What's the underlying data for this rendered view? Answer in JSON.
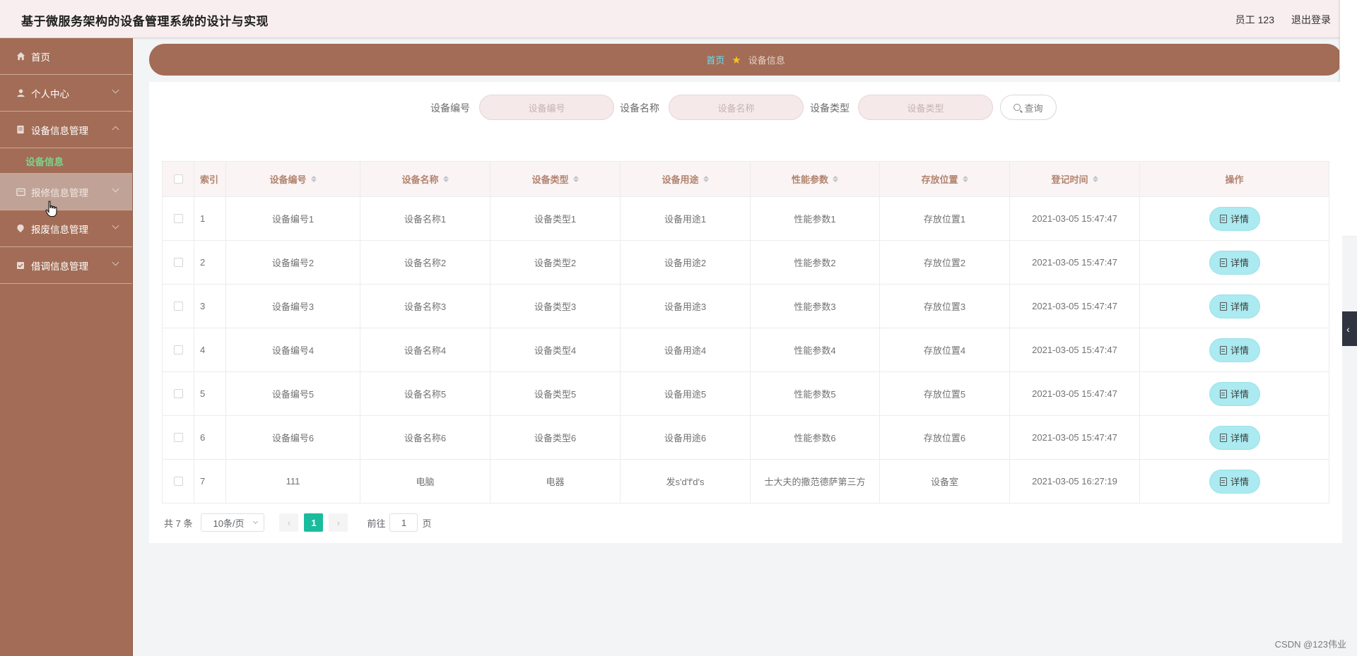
{
  "header": {
    "title": "基于微服务架构的设备管理系统的设计与实现",
    "user": "员工 123",
    "logout": "退出登录"
  },
  "sidebar": {
    "items": [
      {
        "label": "首页",
        "icon": "home-icon"
      },
      {
        "label": "个人中心",
        "icon": "user-icon"
      },
      {
        "label": "设备信息管理",
        "icon": "device-icon"
      },
      {
        "label": "报修信息管理",
        "icon": "repair-icon"
      },
      {
        "label": "报废信息管理",
        "icon": "scrap-icon"
      },
      {
        "label": "借调信息管理",
        "icon": "loan-icon"
      }
    ],
    "sub_item": "设备信息"
  },
  "breadcrumb": {
    "home": "首页",
    "current": "设备信息"
  },
  "search": {
    "fields": [
      {
        "label": "设备编号",
        "placeholder": "设备编号"
      },
      {
        "label": "设备名称",
        "placeholder": "设备名称"
      },
      {
        "label": "设备类型",
        "placeholder": "设备类型"
      }
    ],
    "button": "查询"
  },
  "table": {
    "headers": [
      "索引",
      "设备编号",
      "设备名称",
      "设备类型",
      "设备用途",
      "性能参数",
      "存放位置",
      "登记时间",
      "操作"
    ],
    "rows": [
      [
        "1",
        "设备编号1",
        "设备名称1",
        "设备类型1",
        "设备用途1",
        "性能参数1",
        "存放位置1",
        "2021-03-05 15:47:47"
      ],
      [
        "2",
        "设备编号2",
        "设备名称2",
        "设备类型2",
        "设备用途2",
        "性能参数2",
        "存放位置2",
        "2021-03-05 15:47:47"
      ],
      [
        "3",
        "设备编号3",
        "设备名称3",
        "设备类型3",
        "设备用途3",
        "性能参数3",
        "存放位置3",
        "2021-03-05 15:47:47"
      ],
      [
        "4",
        "设备编号4",
        "设备名称4",
        "设备类型4",
        "设备用途4",
        "性能参数4",
        "存放位置4",
        "2021-03-05 15:47:47"
      ],
      [
        "5",
        "设备编号5",
        "设备名称5",
        "设备类型5",
        "设备用途5",
        "性能参数5",
        "存放位置5",
        "2021-03-05 15:47:47"
      ],
      [
        "6",
        "设备编号6",
        "设备名称6",
        "设备类型6",
        "设备用途6",
        "性能参数6",
        "存放位置6",
        "2021-03-05 15:47:47"
      ],
      [
        "7",
        "111",
        "电脑",
        "电器",
        "发s'd'f'd's",
        "士大夫的撒范德萨第三方",
        "设备室",
        "2021-03-05 16:27:19"
      ]
    ],
    "detail_label": "详情"
  },
  "pagination": {
    "total": "共 7 条",
    "page_size": "10条/页",
    "current_page": "1",
    "goto_label": "前往",
    "goto_value": "1",
    "page_suffix": "页"
  },
  "watermark": "CSDN @123伟业",
  "colors": {
    "sidebar": "#a26c56",
    "accent_green": "#7ed28a",
    "detail_button": "#aaeaf0",
    "active_page": "#1abc9c"
  }
}
